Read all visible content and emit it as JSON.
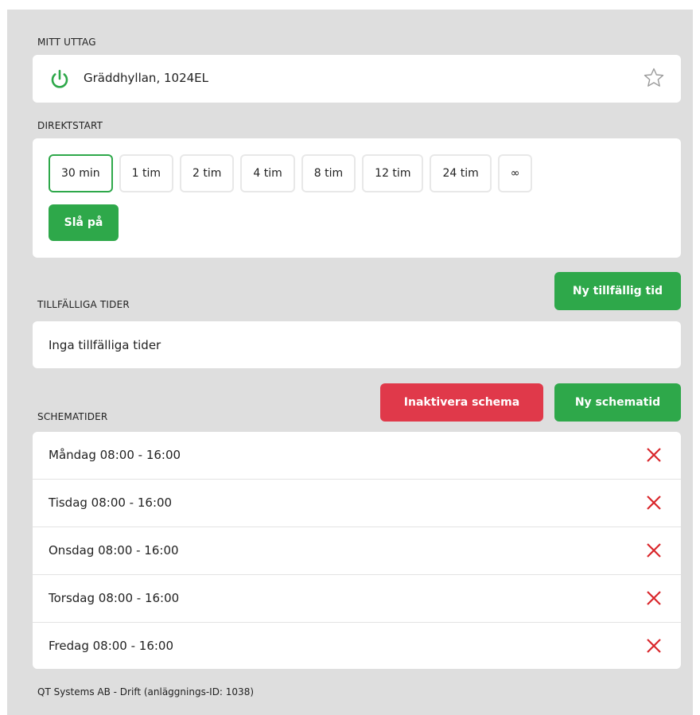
{
  "outlet": {
    "section_label": "MITT UTTAG",
    "name": "Gräddhyllan, 1024EL",
    "status_color": "#2ea84a",
    "power_icon": "power-icon",
    "favorite_icon": "star-outline-icon"
  },
  "direct_start": {
    "section_label": "DIREKTSTART",
    "durations": [
      "30 min",
      "1 tim",
      "2 tim",
      "4 tim",
      "8 tim",
      "12 tim",
      "24 tim",
      "∞"
    ],
    "selected": "30 min",
    "start_button": "Slå på"
  },
  "temporary": {
    "section_label": "TILLFÄLLIGA TIDER",
    "new_button": "Ny tillfällig tid",
    "empty_text": "Inga tillfälliga tider"
  },
  "schedule": {
    "section_label": "SCHEMATIDER",
    "deactivate_button": "Inaktivera schema",
    "new_button": "Ny schematid",
    "items": [
      "Måndag 08:00 - 16:00",
      "Tisdag 08:00 - 16:00",
      "Onsdag 08:00 - 16:00",
      "Torsdag 08:00 - 16:00",
      "Fredag 08:00 - 16:00"
    ],
    "delete_icon": "close-icon"
  },
  "footer": "QT Systems AB - Drift (anläggnings-ID: 1038)",
  "colors": {
    "green": "#2ea84a",
    "red": "#e0394a",
    "delete": "#d9262b",
    "background": "#dedede"
  }
}
